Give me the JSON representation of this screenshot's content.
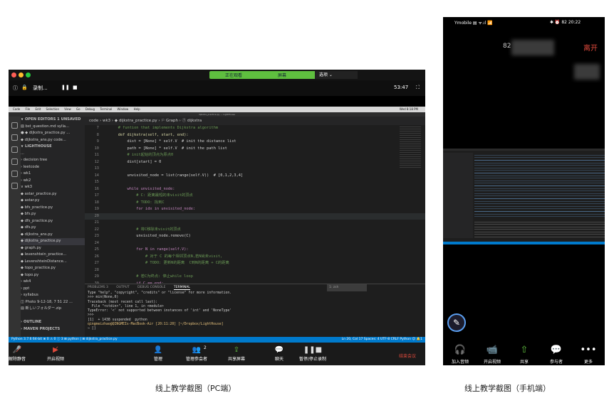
{
  "pc": {
    "share_bar": {
      "left": "正在观看",
      "right": "屏幕",
      "options": "选项 ⌄"
    },
    "zoom_top": {
      "info_icon": "ⓘ",
      "lock_icon": "🔒",
      "record": "录制...",
      "pause": "❚❚",
      "stop": "■",
      "time": "53:47",
      "expand": "⛶"
    },
    "menubar": [
      "Code",
      "File",
      "Edit",
      "Selection",
      "View",
      "Go",
      "Debug",
      "Terminal",
      "Window",
      "Help"
    ],
    "menubar_right": "Wed 8:18 PM",
    "window_title": "dijkstra_practice.py — LightHouse",
    "breadcrumb": "code › wk3 › ◆ dijkstra_practice.py › ⚐ Graph › ⓕ dijkstra",
    "sidebar": {
      "items": [
        {
          "label": "∨ OPEN EDITORS  1 UNSAVED",
          "kind": "head"
        },
        {
          "label": "   ▤ bst_question.md  sylla...",
          "kind": "file"
        },
        {
          "label": " ● ◆ dijkstra_practice.py ...",
          "kind": "file"
        },
        {
          "label": "   ◆ dijkstra_ans.py  code...",
          "kind": "file"
        },
        {
          "label": "∨ LIGHTHOUSE",
          "kind": "head"
        },
        {
          "label": "   ...",
          "kind": "file"
        },
        {
          "label": "  › decision tree",
          "kind": "folder"
        },
        {
          "label": "  › leetcode",
          "kind": "folder"
        },
        {
          "label": "  › wk1",
          "kind": "folder"
        },
        {
          "label": "  › wk2",
          "kind": "folder"
        },
        {
          "label": "  ∨ wk3",
          "kind": "folder"
        },
        {
          "label": "     ◆ astar_practice.py",
          "kind": "file"
        },
        {
          "label": "     ◆ astar.py",
          "kind": "file"
        },
        {
          "label": "     ◆ bfs_practice.py",
          "kind": "file"
        },
        {
          "label": "     ◆ bfs.py",
          "kind": "file"
        },
        {
          "label": "     ◆ dfs_practice.py",
          "kind": "file"
        },
        {
          "label": "     ◆ dfs.py",
          "kind": "file"
        },
        {
          "label": "     ◆ dijkstra_ans.py",
          "kind": "file"
        },
        {
          "label": "     ◆ dijkstra_practice.py",
          "kind": "selected"
        },
        {
          "label": "     ◆ graph.py",
          "kind": "file"
        },
        {
          "label": "     ◆ levenshtein_practice...",
          "kind": "file"
        },
        {
          "label": "     ◆ LevenshteinDistance...",
          "kind": "file"
        },
        {
          "label": "     ◆ topo_practice.py",
          "kind": "file"
        },
        {
          "label": "     ◆ topo.py",
          "kind": "file"
        },
        {
          "label": "  › wk4",
          "kind": "folder"
        },
        {
          "label": "  › ppt",
          "kind": "folder"
        },
        {
          "label": "  › syllabus",
          "kind": "folder"
        },
        {
          "label": "  ◫ Photo 9-12-18, 7 51 22 ...",
          "kind": "file"
        },
        {
          "label": "  ▤ 新しいフォルダー.zip",
          "kind": "file"
        },
        {
          "label": "",
          "kind": "file"
        },
        {
          "label": "› OUTLINE",
          "kind": "head"
        },
        {
          "label": "› MAVEN PROJECTS",
          "kind": "head"
        }
      ]
    },
    "code": [
      {
        "n": "7",
        "t": "    # funtion that implements Dijkstra algorithm",
        "c": "#6a9955"
      },
      {
        "n": "8",
        "t": "    def dijkstra(self, start, end):",
        "c": "#dcdcaa"
      },
      {
        "n": "9",
        "t": "        dist = [None] * self.V  # init the distance list",
        "c": "#d4d4d4"
      },
      {
        "n": "10",
        "t": "        path = [None] * self.V  # init the path list",
        "c": "#d4d4d4"
      },
      {
        "n": "11",
        "t": "        # init起始的顶点为原点0",
        "c": "#6a9955"
      },
      {
        "n": "12",
        "t": "        dist[start] = 0",
        "c": "#d4d4d4"
      },
      {
        "n": "13",
        "t": "",
        "c": "#d4d4d4"
      },
      {
        "n": "14",
        "t": "        unvisited_node = list(range(self.V))  # [0,1,2,3,4]",
        "c": "#d4d4d4"
      },
      {
        "n": "15",
        "t": "",
        "c": "#d4d4d4"
      },
      {
        "n": "16",
        "t": "        while unvisited_node:",
        "c": "#c586c0"
      },
      {
        "n": "17",
        "t": "            # C: 距离最短的未visit的顶点",
        "c": "#6a9955"
      },
      {
        "n": "18",
        "t": "            # TODO: 找到C",
        "c": "#6a9955"
      },
      {
        "n": "19",
        "t": "            for idx in unvisited_node:",
        "c": "#c586c0"
      },
      {
        "n": "20",
        "t": "",
        "c": "#d4d4d4"
      },
      {
        "n": "21",
        "t": "",
        "c": "#d4d4d4"
      },
      {
        "n": "22",
        "t": "            # 将C移除未visit的顶点",
        "c": "#6a9955"
      },
      {
        "n": "23",
        "t": "            unvisited_node.remove(C)",
        "c": "#d4d4d4"
      },
      {
        "n": "24",
        "t": "",
        "c": "#d4d4d4"
      },
      {
        "n": "25",
        "t": "            for N in range(self.V):",
        "c": "#c586c0"
      },
      {
        "n": "26",
        "t": "                # 对于 C 的每个相邻顶点N,若N尚未visit,",
        "c": "#6a9955"
      },
      {
        "n": "27",
        "t": "                # TODO: 更新N的距离  C到N的距离 + C的距离",
        "c": "#6a9955"
      },
      {
        "n": "28",
        "t": "",
        "c": "#d4d4d4"
      },
      {
        "n": "29",
        "t": "            # 若C为终点: 停止while loop",
        "c": "#6a9955"
      },
      {
        "n": "30",
        "t": "            if C == end:",
        "c": "#c586c0"
      },
      {
        "n": "31",
        "t": "                break",
        "c": "#c586c0"
      },
      {
        "n": "32",
        "t": "",
        "c": "#d4d4d4"
      },
      {
        "n": "33",
        "t": "        return path, dist",
        "c": "#c586c0"
      }
    ],
    "panel_tabs": [
      "PROBLEMS 3",
      "OUTPUT",
      "DEBUG CONSOLE",
      "TERMINAL"
    ],
    "panel_select": "1: zsh",
    "terminal": [
      "Type \"help\", \"copyright\", \"credits\" or \"license\" for more information.",
      ">>> min(None,0)",
      "Traceback (most recent call last):",
      "  File \"<stdin>\", line 1, in <module>",
      "TypeError: '<' not supported between instances of 'int' and 'NoneType'",
      ">>>",
      "[1]  + 1438 suspended  python",
      "qingmeizhao@QINGMEIs-MacBook-Air [20:11:20] [~/Dropbox/LightHouse]",
      "→ []"
    ],
    "statusbar_left": "Python 3.7.6 64-bit   ⊗ 0 ⚠ 0 ⓘ 3    ⊞ python | ⊞ dijkstra_practice.py",
    "statusbar_right": "Ln 20, Col 17   Spaces: 4   UTF-8   CRLF   Python   ☺   🔔1",
    "controls": {
      "mute": "解除静音",
      "video": "开启视频",
      "manage": "管理",
      "participants": "管理参会者",
      "participants_count": "2",
      "share": "共享屏幕",
      "chat": "聊天",
      "record": "暂停/停止录制",
      "end": "结束会议"
    }
  },
  "phone": {
    "status_left": "Ymobile ▤ ᯤ.ıl 📶",
    "status_right": "✱ ⏰ 82 20:22",
    "leave": "离开",
    "number": "82",
    "bottom": [
      {
        "icon": "🎧",
        "label": "加入音频"
      },
      {
        "icon": "📹",
        "label": "开启视频"
      },
      {
        "icon": "⇧",
        "label": "共享"
      },
      {
        "icon": "💬",
        "label": "参与者"
      },
      {
        "icon": "•••",
        "label": "更多"
      }
    ]
  },
  "captions": {
    "pc": "线上教学截图（PC端）",
    "phone": "线上教学截图（手机端）"
  },
  "colors": {
    "vscode_blue": "#007acc",
    "zoom_green": "#5fbf3f",
    "end_red": "#e04a3c"
  }
}
